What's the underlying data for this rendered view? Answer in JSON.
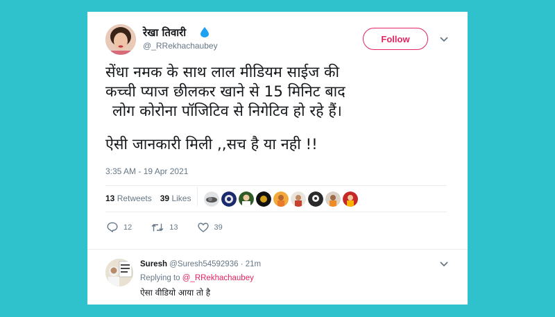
{
  "tweet": {
    "author_name": "रेखा तिवारी",
    "author_handle": "@_RRekhachaubey",
    "follow_label": "Follow",
    "text_lines": [
      "सेंधा नमक के साथ लाल मीडियम साईज की",
      "कच्ची प्याज छीलकर खाने से 15 मिनिट बाद",
      "लोग कोरोना पॉजिटिव से निगेटिव हो रहे हैं।",
      "ऐसी जानकारी मिली ,,सच है या नही !!"
    ],
    "timestamp": "3:35 AM - 19 Apr 2021",
    "retweets_count": "13",
    "retweets_label": "Retweets",
    "likes_count": "39",
    "likes_label": "Likes",
    "reply_count": "12",
    "retweet_action_count": "13",
    "like_action_count": "39"
  },
  "reply": {
    "author_name": "Suresh",
    "author_handle": "@Suresh54592936",
    "time": "· 21m",
    "replying_prefix": "Replying to",
    "replying_to": "@_RRekhachaubey",
    "text": "ऐसा वीडियो आया तो है"
  },
  "colors": {
    "background": "#2fc1cc",
    "accent": "#e0245e",
    "muted": "#657786"
  },
  "icons": {
    "drop": "water-drop-icon",
    "menu": "chevron-down-icon",
    "reply": "reply-icon",
    "retweet": "retweet-icon",
    "like": "heart-icon"
  }
}
